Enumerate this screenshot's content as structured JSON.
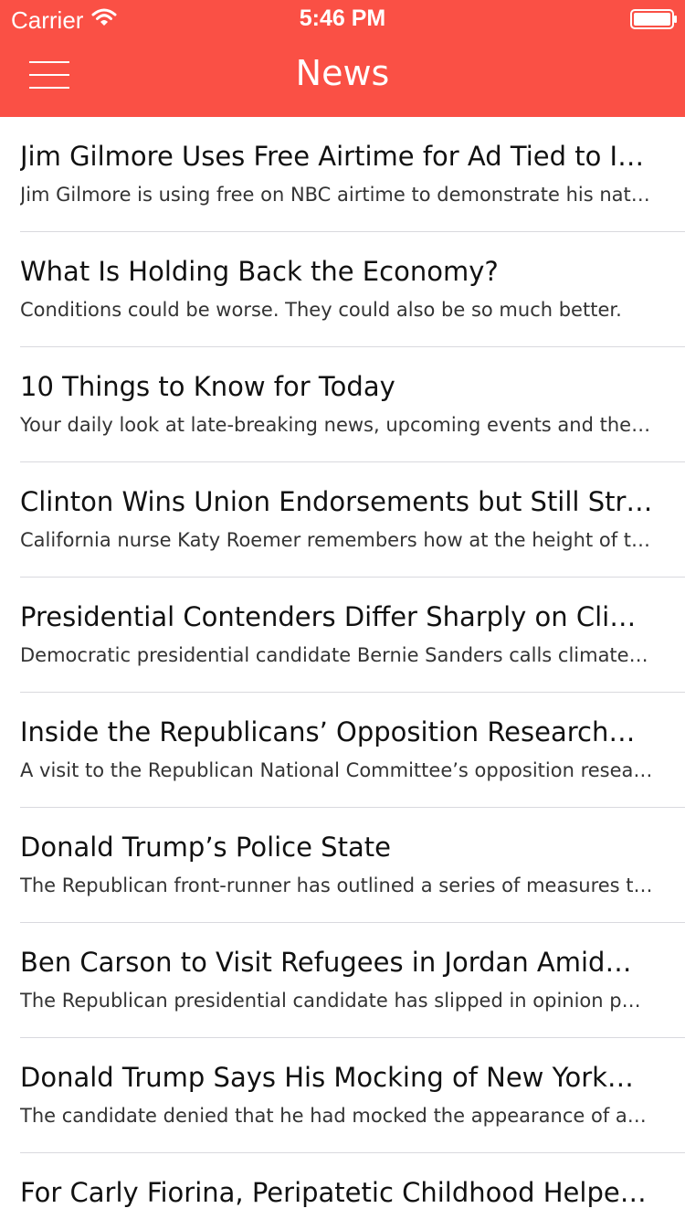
{
  "status_bar": {
    "carrier": "Carrier",
    "time": "5:46 PM",
    "wifi_icon": "wifi-icon",
    "battery_icon": "battery-icon"
  },
  "nav_bar": {
    "title": "News",
    "menu_icon": "hamburger-menu-icon",
    "color": "#fa5045"
  },
  "articles": [
    {
      "title": "Jim Gilmore Uses Free Airtime for Ad Tied to I…",
      "summary": "Jim Gilmore is using free on NBC airtime to demonstrate his nat…"
    },
    {
      "title": "What Is Holding Back the Economy?",
      "summary": "Conditions could be worse. They could also be so much better."
    },
    {
      "title": "10 Things to Know for Today",
      "summary": "Your daily look at late-breaking news, upcoming events and the…"
    },
    {
      "title": "Clinton Wins Union Endorsements but Still Str…",
      "summary": "California nurse Katy Roemer remembers how at the height of t…"
    },
    {
      "title": "Presidential Contenders Differ Sharply on Cli…",
      "summary": "Democratic presidential candidate Bernie Sanders calls climate…"
    },
    {
      "title": "Inside the Republicans’ Opposition Research…",
      "summary": "A visit to the Republican National Committee’s opposition resea…"
    },
    {
      "title": "Donald Trump’s Police State",
      "summary": "The Republican front-runner has outlined a series of measures t…"
    },
    {
      "title": "Ben Carson to Visit Refugees in Jordan Amid…",
      "summary": "The Republican presidential candidate has slipped in opinion p…"
    },
    {
      "title": "Donald Trump Says His Mocking of New York…",
      "summary": "The candidate denied that he had mocked the appearance of a…"
    },
    {
      "title": "For Carly Fiorina, Peripatetic Childhood Helpe…",
      "summary": ""
    }
  ]
}
